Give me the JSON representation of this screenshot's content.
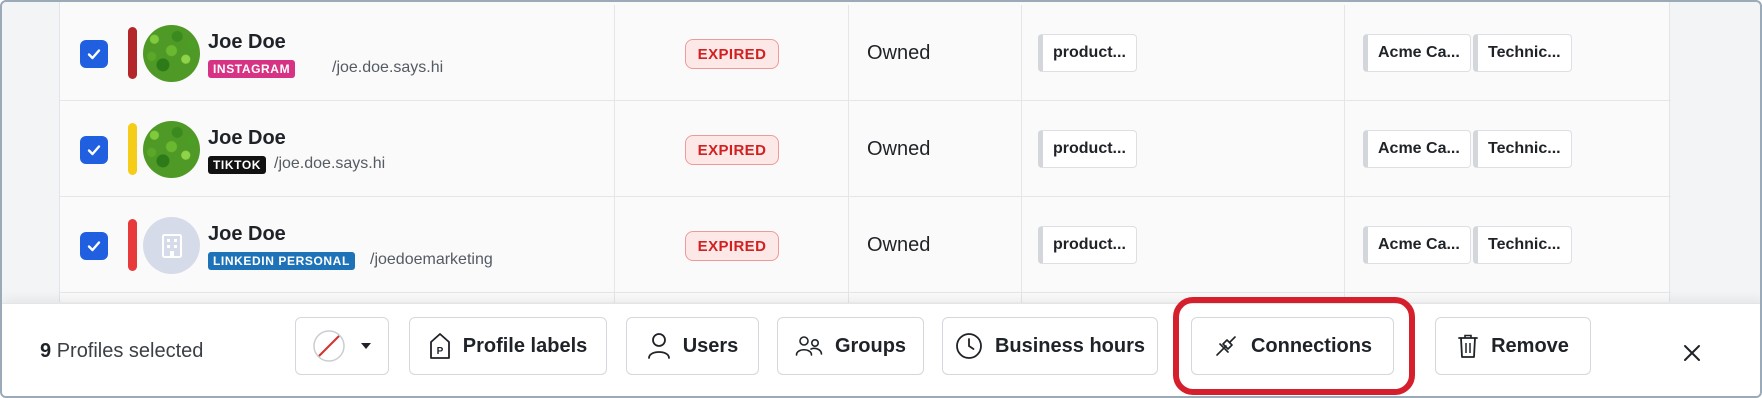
{
  "rows": [
    {
      "name": "Joe Doe",
      "platform": "INSTAGRAM",
      "platform_color": "#d63384",
      "stripe_color": "#b3262a",
      "handle": "/joe.doe.says.hi",
      "avatar": "moss-photo",
      "status": "EXPIRED",
      "ownership": "Owned",
      "labels": [
        "product..."
      ],
      "groups": [
        "Acme Ca...",
        "Technic..."
      ]
    },
    {
      "name": "Joe Doe",
      "platform": "TIKTOK",
      "platform_color": "#111111",
      "stripe_color": "#f5cc17",
      "handle": "/joe.doe.says.hi",
      "avatar": "moss-photo",
      "status": "EXPIRED",
      "ownership": "Owned",
      "labels": [
        "product..."
      ],
      "groups": [
        "Acme Ca...",
        "Technic..."
      ]
    },
    {
      "name": "Joe Doe",
      "platform": "LINKEDIN PERSONAL",
      "platform_color": "#1e73b8",
      "stripe_color": "#e83a3a",
      "handle": "/joedoemarketing",
      "avatar": "building-icon",
      "status": "EXPIRED",
      "ownership": "Owned",
      "labels": [
        "product..."
      ],
      "groups": [
        "Acme Ca...",
        "Technic..."
      ]
    }
  ],
  "action_bar": {
    "selected_count": "9",
    "selected_text": "Profiles selected",
    "color_picker": {
      "icon": "no-color-icon",
      "dropdown_icon": "caret-down-icon"
    },
    "buttons": [
      {
        "key": "profile_labels",
        "label": "Profile labels",
        "icon": "tag-icon"
      },
      {
        "key": "users",
        "label": "Users",
        "icon": "user-icon"
      },
      {
        "key": "groups",
        "label": "Groups",
        "icon": "users-group-icon"
      },
      {
        "key": "business_hours",
        "label": "Business hours",
        "icon": "clock-icon"
      },
      {
        "key": "connections",
        "label": "Connections",
        "icon": "plug-icon"
      },
      {
        "key": "remove",
        "label": "Remove",
        "icon": "trash-icon"
      }
    ],
    "highlight_color": "#d61f2c",
    "close_icon": "close-icon"
  }
}
